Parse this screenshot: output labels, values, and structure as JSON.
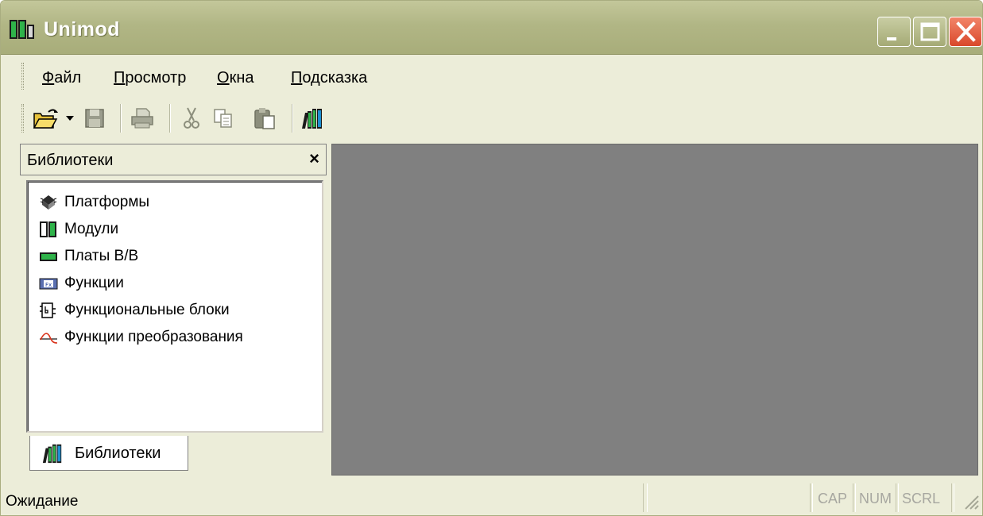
{
  "window": {
    "title": "Unimod"
  },
  "menu": {
    "items": [
      {
        "label": "Файл",
        "underline": "Ф",
        "rest": "айл"
      },
      {
        "label": "Просмотр",
        "underline": "П",
        "rest": "росмотр"
      },
      {
        "label": "Окна",
        "underline": "О",
        "rest": "кна"
      },
      {
        "label": "Подсказка",
        "underline": "П",
        "rest": "одсказка"
      }
    ]
  },
  "toolbar": {
    "buttons": [
      "open-icon",
      "dropdown-arrow-icon",
      "save-icon",
      "print-icon",
      "cut-icon",
      "copy-icon",
      "paste-icon",
      "library-icon"
    ]
  },
  "libraries_panel": {
    "title": "Библиотеки",
    "close_glyph": "×",
    "items": [
      {
        "label": "Платформы",
        "icon": "platform-icon"
      },
      {
        "label": "Модули",
        "icon": "module-icon"
      },
      {
        "label": "Платы В/В",
        "icon": "io-board-icon"
      },
      {
        "label": "Функции",
        "icon": "function-icon"
      },
      {
        "label": "Функциональные блоки",
        "icon": "function-block-icon"
      },
      {
        "label": "Функции преобразования",
        "icon": "transform-function-icon"
      }
    ],
    "tab_label": "Библиотеки"
  },
  "statusbar": {
    "text": "Ожидание",
    "indicators": [
      "CAP",
      "NUM",
      "SCRL"
    ]
  },
  "colors": {
    "mdi_background": "#808080",
    "chrome": "#ecedd9",
    "titlebar": "#b1b685",
    "close_button": "#d9482b"
  }
}
